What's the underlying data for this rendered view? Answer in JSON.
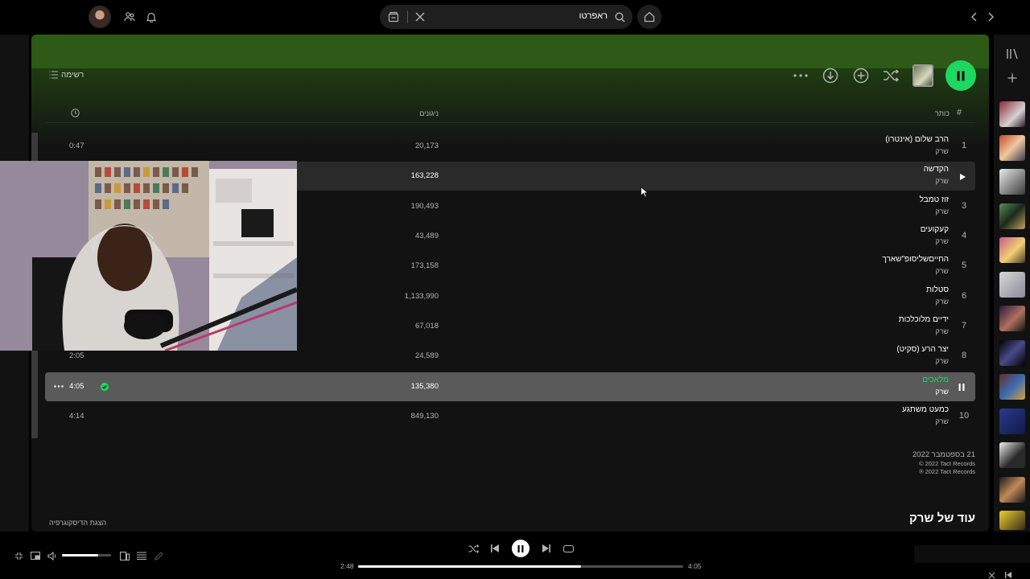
{
  "search": {
    "value": "ראפרטו"
  },
  "list_view": {
    "label": "רשימה"
  },
  "table": {
    "col_number": "#",
    "col_title": "כותר",
    "col_plays": "ניגונים"
  },
  "tracks": [
    {
      "num": "1",
      "title": "הרב שלום (אינטרו)",
      "artist": "שרק",
      "plays": "20,173",
      "duration": "0:47"
    },
    {
      "num": "",
      "title": "הקדשה",
      "artist": "שרק",
      "plays": "163,228",
      "duration": ""
    },
    {
      "num": "3",
      "title": "זוז טמבל",
      "artist": "שרק",
      "plays": "190,493",
      "duration": ""
    },
    {
      "num": "4",
      "title": "קעקועים",
      "artist": "שרק",
      "plays": "43,489",
      "duration": ""
    },
    {
      "num": "5",
      "title": "החייםשליסופ\"שארך",
      "artist": "שרק",
      "plays": "173,158",
      "duration": ""
    },
    {
      "num": "6",
      "title": "סטלות",
      "artist": "שרק",
      "plays": "1,133,990",
      "duration": ""
    },
    {
      "num": "7",
      "title": "ידיים מלוכלכות",
      "artist": "שרק",
      "plays": "67,018",
      "duration": ""
    },
    {
      "num": "8",
      "title": "יצר הרע (סקיט)",
      "artist": "שרק",
      "plays": "24,589",
      "duration": "2:05"
    },
    {
      "num": "",
      "title": "מלאכים",
      "artist": "שרק",
      "plays": "135,380",
      "duration": "4:05"
    },
    {
      "num": "10",
      "title": "כמעט משתגע",
      "artist": "שרק",
      "plays": "849,130",
      "duration": "4:14"
    }
  ],
  "release": {
    "date": "21 בספטמבר 2022",
    "copyright_c": "© 2022 Tact Records",
    "copyright_p": "℗ 2022 Tact Records"
  },
  "more_by": "עוד של שרק",
  "show_discography": "הצגת הדיסקוגרפיה",
  "player": {
    "elapsed": "2:48",
    "total": "4:05",
    "progress_fraction": 0.686,
    "volume_fraction": 0.73
  },
  "colors": {
    "accent": "#1ed760",
    "header_green": "#2d5a17"
  }
}
